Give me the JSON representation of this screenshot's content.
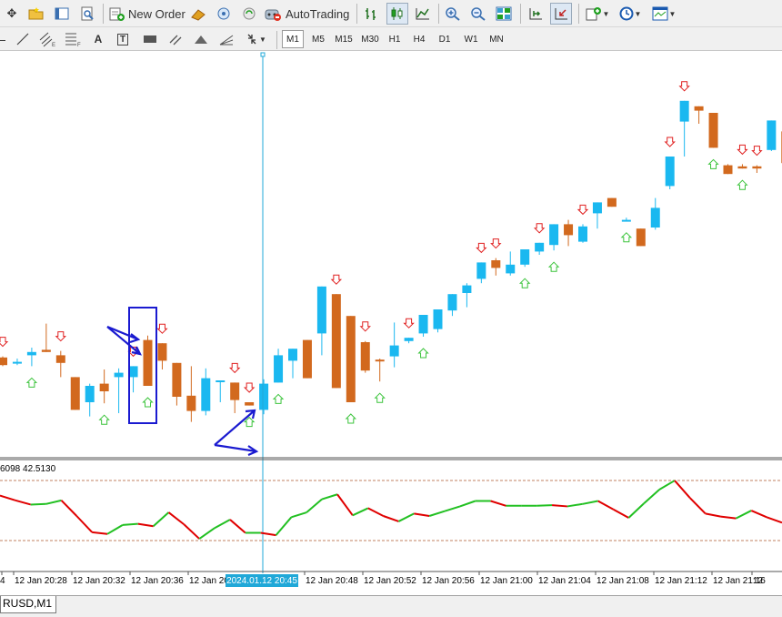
{
  "toolbar": {
    "new_order_label": "New Order",
    "autotrading_label": "AutoTrading"
  },
  "drawing_toolbar": {
    "text_tool_label": "A",
    "label_tool_label": "T"
  },
  "timeframes": [
    "M1",
    "M5",
    "M15",
    "M30",
    "H1",
    "H4",
    "D1",
    "W1",
    "MN"
  ],
  "active_timeframe": "M1",
  "indicator_header": "6098 42.5130",
  "crosshair_label": "2024.01.12 20:45",
  "time_labels": [
    "4",
    "12 Jan 20:28",
    "12 Jan 20:32",
    "12 Jan 20:36",
    "12 Jan 20",
    "12 Jan 20:48",
    "12 Jan 20:52",
    "12 Jan 20:56",
    "12 Jan 21:00",
    "12 Jan 21:04",
    "12 Jan 21:08",
    "12 Jan 21:12",
    "12 Jan 21:16",
    "12"
  ],
  "symbol_tab": "RUSD,M1",
  "colors": {
    "bull": "#1ab8f0",
    "bear": "#d2691e",
    "up_arrow": "#3cc43c",
    "down_arrow": "#e02020",
    "crosshair": "#20a8d8",
    "annotation": "#1a1ad0",
    "osc_down": "#e00000",
    "osc_up": "#22c022",
    "level_line": "#c08060"
  },
  "chart_data": {
    "type": "candlestick",
    "candles": [
      {
        "o": 6,
        "h": 7,
        "l": -2,
        "c": -1
      },
      {
        "o": 2,
        "h": 5,
        "l": -1,
        "c": 2
      },
      {
        "o": 8,
        "h": 15,
        "l": -2,
        "c": 11
      },
      {
        "o": 13,
        "h": 37,
        "l": 12,
        "c": 11
      },
      {
        "o": 8,
        "h": 12,
        "l": -12,
        "c": 1
      },
      {
        "o": -12,
        "h": -12,
        "l": -42,
        "c": -42
      },
      {
        "o": -35,
        "h": -18,
        "l": -48,
        "c": -20
      },
      {
        "o": -18,
        "h": -5,
        "l": -36,
        "c": -25
      },
      {
        "o": -12,
        "h": -4,
        "l": -45,
        "c": -8
      },
      {
        "o": -12,
        "h": -2,
        "l": -26,
        "c": -2
      },
      {
        "o": 22,
        "h": 26,
        "l": -20,
        "c": -20
      },
      {
        "o": 19,
        "h": 19,
        "l": -5,
        "c": 3
      },
      {
        "o": 1,
        "h": 1,
        "l": -38,
        "c": -30
      },
      {
        "o": -29,
        "h": -2,
        "l": -53,
        "c": -43
      },
      {
        "o": -43,
        "h": -4,
        "l": -47,
        "c": -13
      },
      {
        "o": -16,
        "h": -16,
        "l": -35,
        "c": -15
      },
      {
        "o": -17,
        "h": -17,
        "l": -45,
        "c": -33
      },
      {
        "o": -35,
        "h": -35,
        "l": -35,
        "c": -38
      },
      {
        "o": -42,
        "h": -14,
        "l": -46,
        "c": -18
      },
      {
        "o": -17,
        "h": 14,
        "l": -17,
        "c": 8
      },
      {
        "o": 3,
        "h": 8,
        "l": -13,
        "c": 14
      },
      {
        "o": 22,
        "h": 22,
        "l": -13,
        "c": -13
      },
      {
        "o": 28,
        "h": 68,
        "l": 8,
        "c": 71
      },
      {
        "o": 64,
        "h": 64,
        "l": -22,
        "c": -22
      },
      {
        "o": 44,
        "h": 44,
        "l": -35,
        "c": -35
      },
      {
        "o": 20,
        "h": 21,
        "l": -8,
        "c": -6
      },
      {
        "o": 4,
        "h": 5,
        "l": -16,
        "c": 3
      },
      {
        "o": 7,
        "h": 38,
        "l": -3,
        "c": 17
      },
      {
        "o": 21,
        "h": 24,
        "l": 19,
        "c": 24
      },
      {
        "o": 28,
        "h": 31,
        "l": 25,
        "c": 45
      },
      {
        "o": 32,
        "h": 50,
        "l": 29,
        "c": 50
      },
      {
        "o": 49,
        "h": 51,
        "l": 44,
        "c": 64
      },
      {
        "o": 65,
        "h": 74,
        "l": 52,
        "c": 72
      },
      {
        "o": 78,
        "h": 78,
        "l": 74,
        "c": 93
      },
      {
        "o": 95,
        "h": 97,
        "l": 81,
        "c": 88
      },
      {
        "o": 83,
        "h": 103,
        "l": 81,
        "c": 91
      },
      {
        "o": 91,
        "h": 103,
        "l": 89,
        "c": 105
      },
      {
        "o": 103,
        "h": 104,
        "l": 100,
        "c": 111
      },
      {
        "o": 109,
        "h": 125,
        "l": 104,
        "c": 128
      },
      {
        "o": 128,
        "h": 132,
        "l": 108,
        "c": 118
      },
      {
        "o": 112,
        "h": 128,
        "l": 111,
        "c": 126
      },
      {
        "o": 138,
        "h": 143,
        "l": 124,
        "c": 148
      },
      {
        "o": 152,
        "h": 152,
        "l": 144,
        "c": 144
      },
      {
        "o": 132,
        "h": 134,
        "l": 131,
        "c": 132
      },
      {
        "o": 124,
        "h": 124,
        "l": 108,
        "c": 108
      },
      {
        "o": 125,
        "h": 152,
        "l": 123,
        "c": 143
      },
      {
        "o": 163,
        "h": 176,
        "l": 160,
        "c": 190
      },
      {
        "o": 222,
        "h": 232,
        "l": 190,
        "c": 241
      },
      {
        "o": 236,
        "h": 236,
        "l": 220,
        "c": 232
      },
      {
        "o": 230,
        "h": 230,
        "l": 210,
        "c": 198
      },
      {
        "o": 182,
        "h": 183,
        "l": 178,
        "c": 174
      },
      {
        "o": 181,
        "h": 183,
        "l": 179,
        "c": 179
      },
      {
        "o": 181,
        "h": 182,
        "l": 175,
        "c": 179
      },
      {
        "o": 196,
        "h": 223,
        "l": 195,
        "c": 223
      },
      {
        "o": 213,
        "h": 213,
        "l": 195,
        "c": 184
      }
    ],
    "oscillator": [
      84,
      76,
      69,
      70,
      76,
      50,
      23,
      20,
      35,
      37,
      33,
      56,
      36,
      12,
      30,
      44,
      22,
      22,
      18,
      48,
      56,
      78,
      86,
      51,
      63,
      50,
      41,
      54,
      50,
      58,
      66,
      75,
      75,
      67,
      67,
      67,
      68,
      66,
      70,
      75,
      61,
      47,
      71,
      94,
      109,
      80,
      54,
      49,
      46,
      59,
      48,
      39
    ],
    "oscillator_levels": [
      70,
      30
    ]
  }
}
